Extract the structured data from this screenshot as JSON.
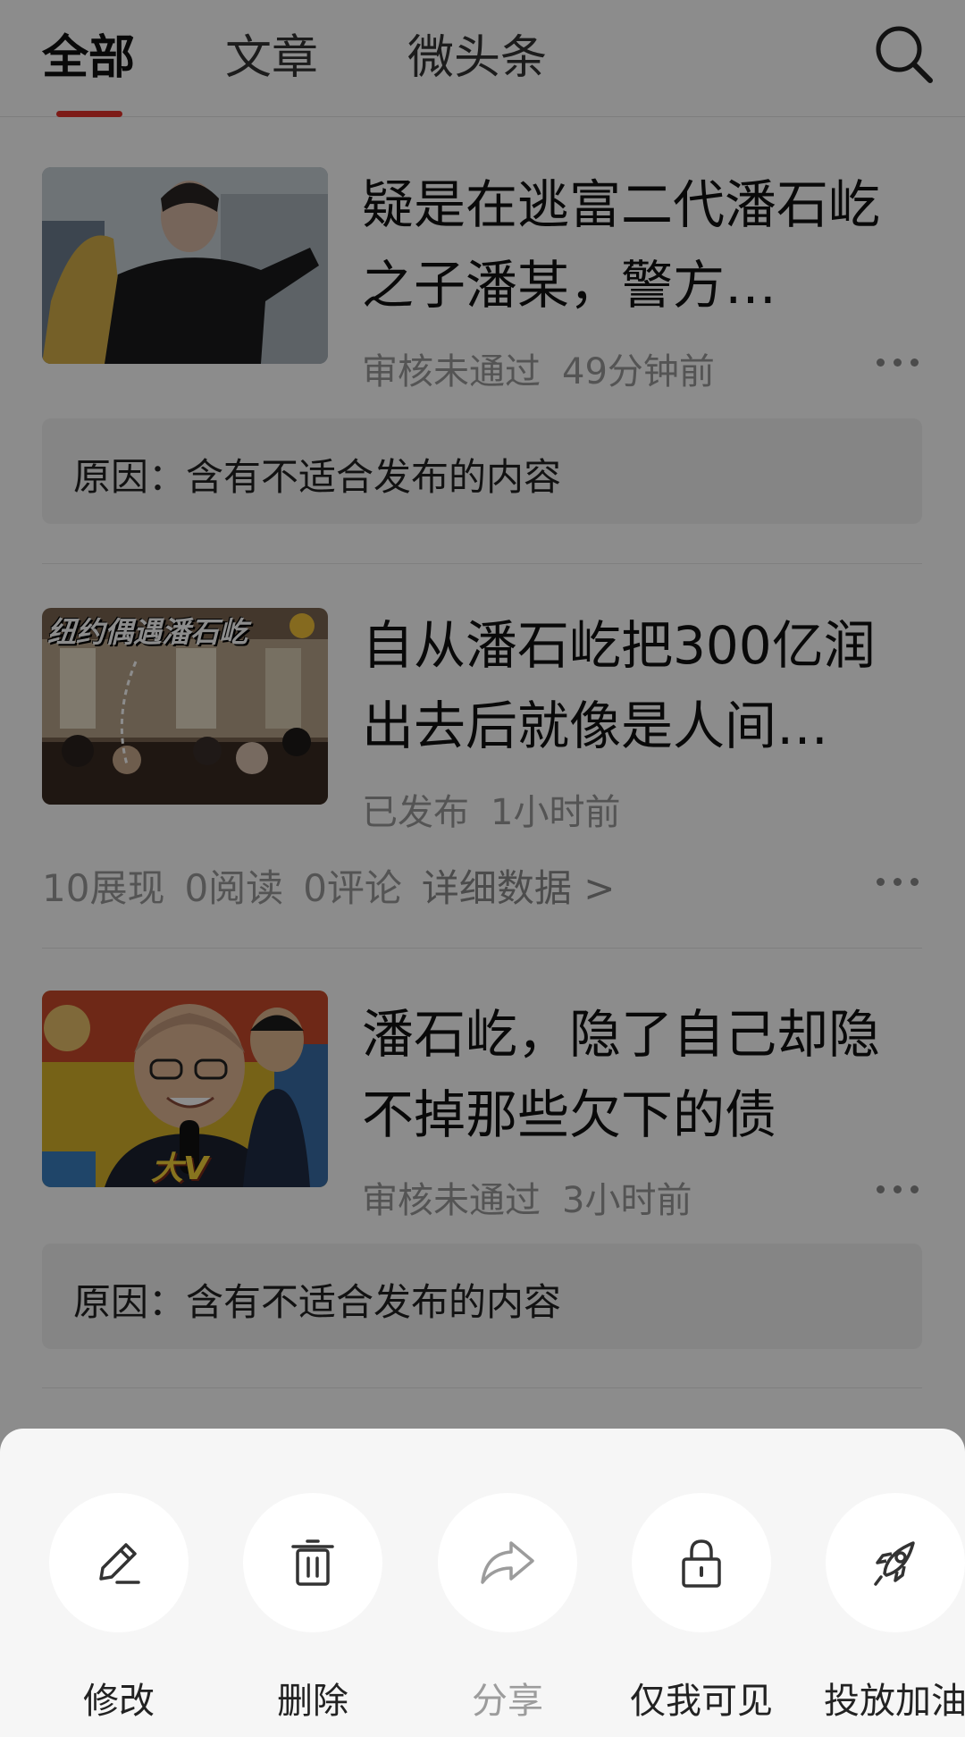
{
  "tabs": [
    {
      "label": "全部",
      "active": true
    },
    {
      "label": "文章",
      "active": false
    },
    {
      "label": "微头条",
      "active": false
    }
  ],
  "accent_color": "#e3322b",
  "items": [
    {
      "title": "疑是在逃富二代潘石屹之子潘某，警方…",
      "status": "审核未通过",
      "time": "49分钟前",
      "reason": "原因：含有不适合发布的内容",
      "thumb_caption": ""
    },
    {
      "title": "自从潘石屹把300亿润出去后就像是人间…",
      "status": "已发布",
      "time": "1小时前",
      "thumb_caption": "纽约偶遇潘石屹",
      "stats": {
        "impressions": "10展现",
        "reads": "0阅读",
        "comments": "0评论",
        "detail": "详细数据 >"
      }
    },
    {
      "title": "潘石屹，隐了自己却隐不掉那些欠下的债",
      "status": "审核未通过",
      "time": "3小时前",
      "reason": "原因：含有不适合发布的内容",
      "thumb_caption": "大V"
    }
  ],
  "actions": [
    {
      "label": "修改",
      "icon": "pencil-icon",
      "enabled": true
    },
    {
      "label": "删除",
      "icon": "trash-icon",
      "enabled": true
    },
    {
      "label": "分享",
      "icon": "share-arrow-icon",
      "enabled": false
    },
    {
      "label": "仅我可见",
      "icon": "lock-icon",
      "enabled": true
    },
    {
      "label": "投放加油包",
      "icon": "rocket-icon",
      "enabled": true
    }
  ]
}
